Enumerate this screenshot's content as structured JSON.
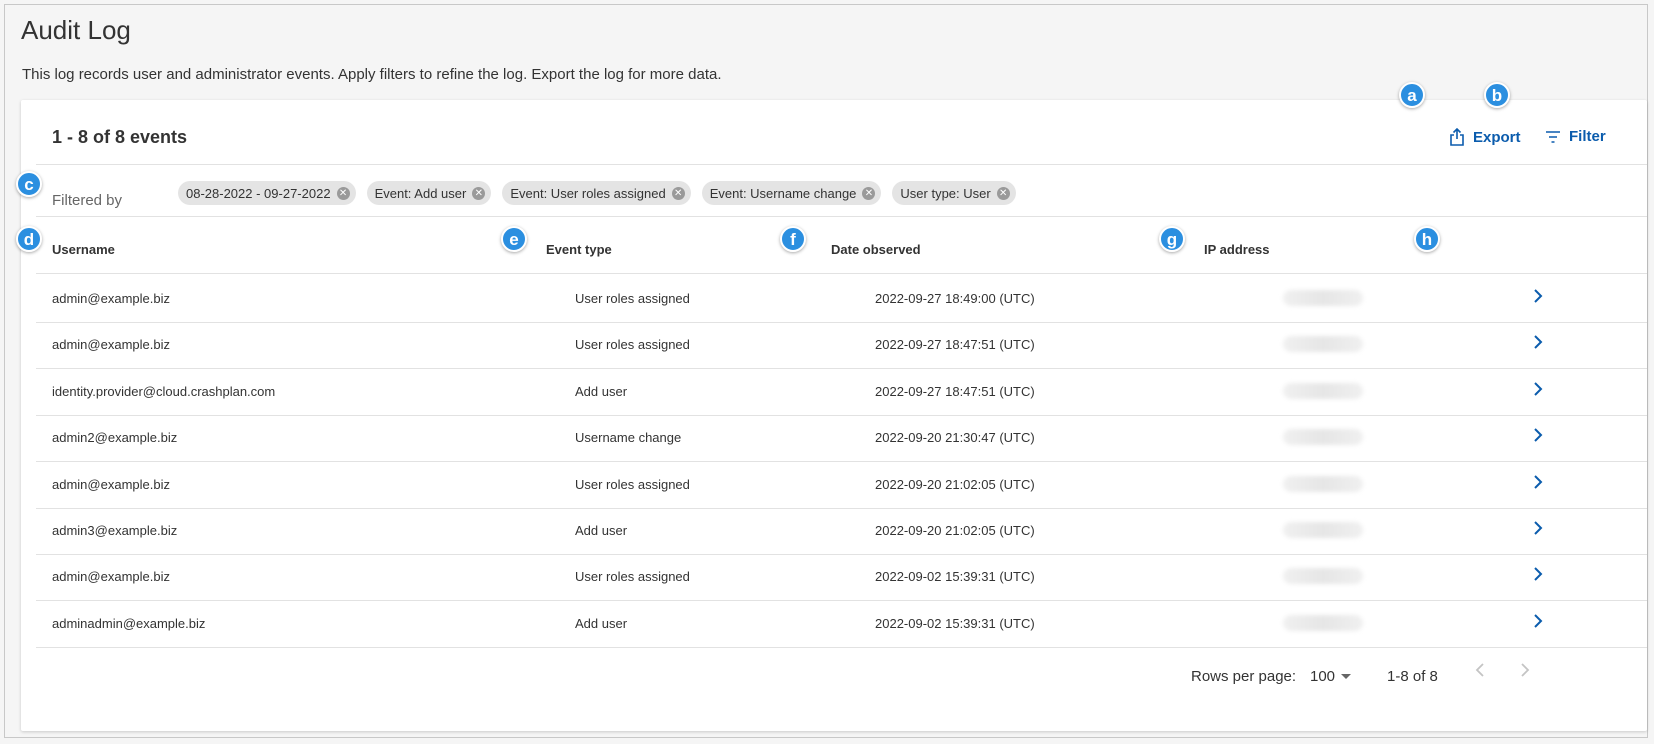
{
  "page": {
    "title": "Audit Log",
    "description": "This log records user and administrator events. Apply filters to refine the log. Export the log for more data."
  },
  "summary": {
    "count_label": "1 - 8 of 8 events"
  },
  "actions": {
    "export_label": "Export",
    "filter_label": "Filter"
  },
  "filters": {
    "label": "Filtered by",
    "chips": [
      "08-28-2022 - 09-27-2022",
      "Event: Add user",
      "Event: User roles assigned",
      "Event: Username change",
      "User type: User"
    ]
  },
  "table": {
    "headers": {
      "username": "Username",
      "event_type": "Event type",
      "date_observed": "Date observed",
      "ip_address": "IP address"
    },
    "rows": [
      {
        "username": "admin@example.biz",
        "event": "User roles assigned",
        "date": "2022-09-27 18:49:00 (UTC)"
      },
      {
        "username": "admin@example.biz",
        "event": "User roles assigned",
        "date": "2022-09-27 18:47:51 (UTC)"
      },
      {
        "username": "identity.provider@cloud.crashplan.com",
        "event": "Add user",
        "date": "2022-09-27 18:47:51 (UTC)"
      },
      {
        "username": "admin2@example.biz",
        "event": "Username change",
        "date": "2022-09-20 21:30:47 (UTC)"
      },
      {
        "username": "admin@example.biz",
        "event": "User roles assigned",
        "date": "2022-09-20 21:02:05 (UTC)"
      },
      {
        "username": "admin3@example.biz",
        "event": "Add user",
        "date": "2022-09-20 21:02:05 (UTC)"
      },
      {
        "username": "admin@example.biz",
        "event": "User roles assigned",
        "date": "2022-09-02 15:39:31 (UTC)"
      },
      {
        "username": "adminadmin@example.biz",
        "event": "Add user",
        "date": "2022-09-02 15:39:31 (UTC)"
      }
    ]
  },
  "pagination": {
    "rows_per_page_label": "Rows per page:",
    "rows_per_page_value": "100",
    "range": "1-8 of 8"
  },
  "callouts": [
    "a",
    "b",
    "c",
    "d",
    "e",
    "f",
    "g",
    "h"
  ],
  "colors": {
    "accent": "#0b5cad",
    "callout": "#2b8fe0"
  }
}
